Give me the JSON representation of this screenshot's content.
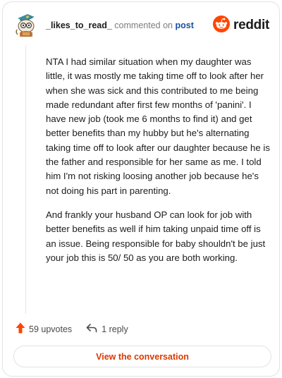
{
  "header": {
    "username": "_likes_to_read_",
    "action_text": "commented on",
    "post_link": "post",
    "brand": "reddit"
  },
  "comment": {
    "paragraphs": [
      "NTA I had similar situation when my daughter was little, it was mostly me taking time off to look after her when she was sick and this contributed to me being made redundant after first few months of 'panini'. I have new job (took me 6 months to find it) and get better benefits than my hubby but he's alternating taking time off to look after our daughter because he is the father and responsible for her same as me. I told him I'm not risking loosing another job because he's not doing his part in parenting.",
      "And frankly your husband OP can look for job with better benefits as well if him taking unpaid time off is an issue. Being responsible for baby shouldn't be just your job this is 50/ 50 as you are both working."
    ]
  },
  "footer": {
    "upvotes": "59 upvotes",
    "replies": "1 reply"
  },
  "actions": {
    "view_conversation": "View the conversation"
  },
  "icons": {
    "avatar": "avatar-icon",
    "brand_logo": "reddit-logo-icon",
    "upvote": "upvote-arrow-icon",
    "reply": "reply-arrow-icon"
  },
  "colors": {
    "upvote": "#ff4500",
    "brand": "#ff4500",
    "link": "#1a4fa3",
    "cta": "#d93a00"
  }
}
